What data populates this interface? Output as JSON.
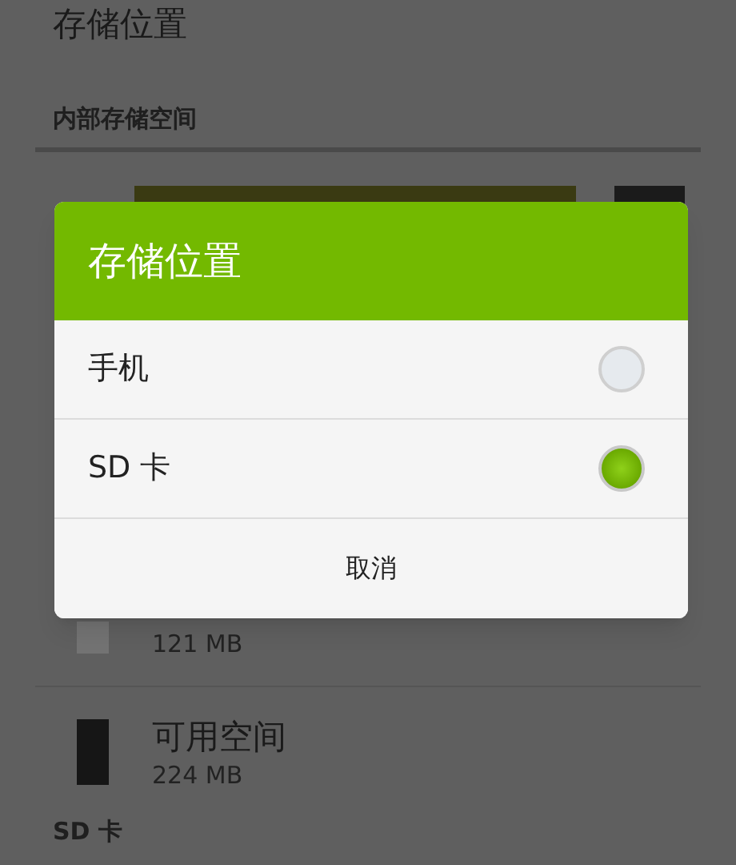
{
  "page": {
    "title": "存储位置",
    "sections": [
      {
        "header": "内部存储空间",
        "items": [
          {
            "size": "121 MB",
            "color": "#737373"
          },
          {
            "label": "可用空间",
            "size": "224 MB",
            "color": "#161616"
          }
        ]
      },
      {
        "header": "SD 卡"
      }
    ]
  },
  "dialog": {
    "title": "存储位置",
    "options": [
      {
        "label": "手机",
        "selected": false
      },
      {
        "label": "SD 卡",
        "selected": true
      }
    ],
    "cancel": "取消"
  }
}
